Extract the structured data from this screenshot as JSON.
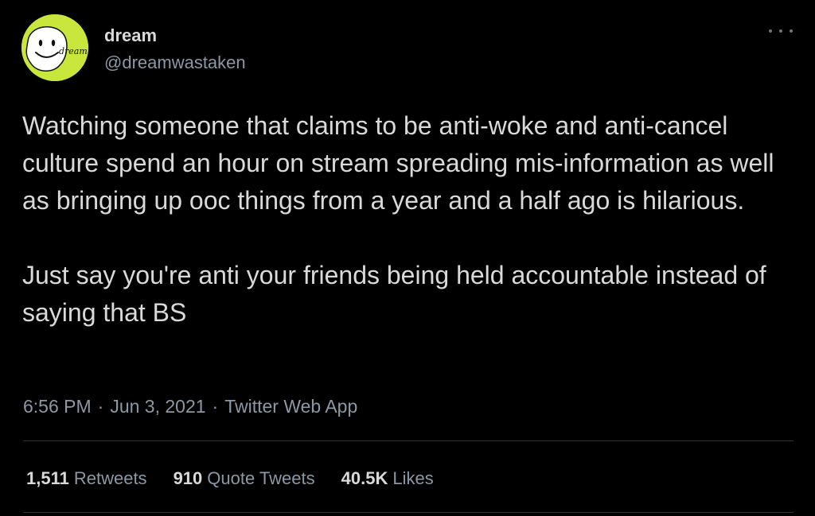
{
  "author": {
    "display_name": "dream",
    "handle": "@dreamwastaken",
    "avatar_text": "dream",
    "avatar_color": "#c8e63c"
  },
  "more_icon": "more-horizontal-icon",
  "tweet": {
    "paragraphs": [
      "Watching someone that claims to be anti-woke and anti-cancel culture spend an hour on stream spreading mis-information as well as bringing up ooc things from a year and a half ago is hilarious.",
      "Just say you're anti your friends being held accountable instead of saying that BS"
    ],
    "time": "6:56 PM",
    "date": "Jun 3, 2021",
    "source": "Twitter Web App",
    "separator": "·"
  },
  "stats": {
    "retweets": {
      "count": "1,511",
      "label": "Retweets"
    },
    "quote_tweets": {
      "count": "910",
      "label": "Quote Tweets"
    },
    "likes": {
      "count": "40.5K",
      "label": "Likes"
    }
  },
  "colors": {
    "background": "#000000",
    "primary_text": "#d9d9d9",
    "secondary_text": "#8b98a5",
    "divider": "#2f3336"
  }
}
